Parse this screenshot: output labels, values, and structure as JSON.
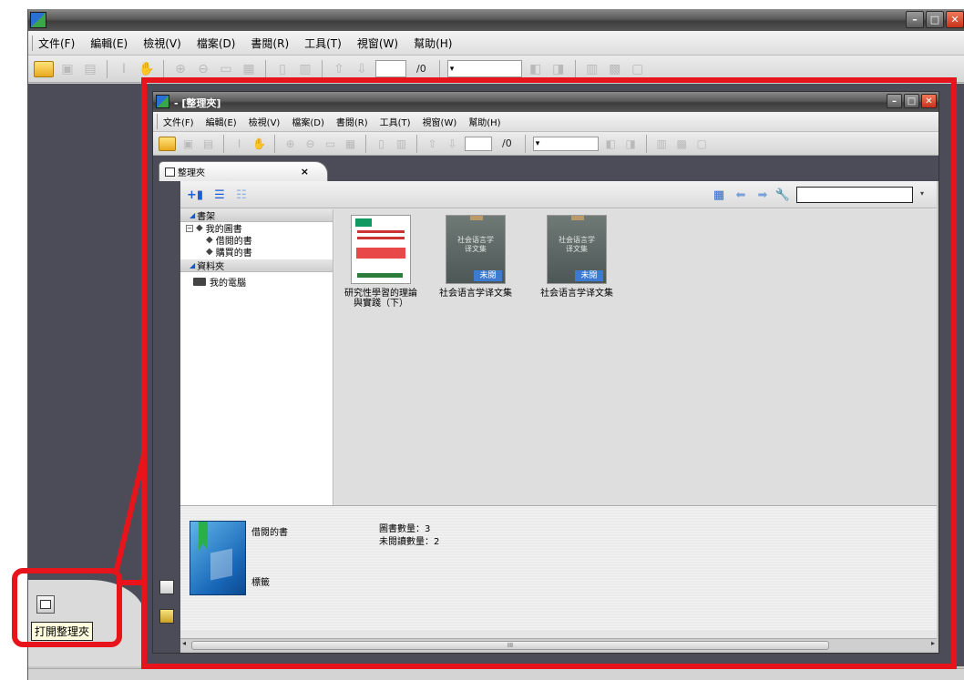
{
  "app": {
    "menu": [
      "文件(F)",
      "編輯(E)",
      "檢視(V)",
      "檔案(D)",
      "書閱(R)",
      "工具(T)",
      "視窗(W)",
      "幫助(H)"
    ],
    "window_buttons": [
      "–",
      "□",
      "✕"
    ],
    "toolbar": {
      "page_total": "/0",
      "zoom_arrow": "▾"
    },
    "tooltip": "打開整理夾"
  },
  "inner": {
    "title": "- [整理夾]",
    "menu": [
      "文件(F)",
      "編輯(E)",
      "檢視(V)",
      "檔案(D)",
      "書閱(R)",
      "工具(T)",
      "視窗(W)",
      "幫助(H)"
    ],
    "toolbar": {
      "page_total": "/0",
      "zoom_arrow": "▾"
    },
    "tab": {
      "label": "整理夾",
      "close": "×"
    },
    "tree": {
      "bookshelf": "書架",
      "my_books": "我的圖書",
      "borrowed": "借閱的書",
      "purchased": "購買的書",
      "folders": "資料夾",
      "my_computer": "我的電腦"
    },
    "books": [
      {
        "title": "研究性學習的理論與實踐（下）",
        "unread": ""
      },
      {
        "title": "社会语言学译文集",
        "cover_text": "社会语言学\n译文集",
        "unread": "未閱"
      },
      {
        "title": "社会语言学译文集",
        "cover_text": "社会语言学\n译文集",
        "unread": "未閱"
      }
    ],
    "info": {
      "shelf_name": "借閱的書",
      "tag_label": "標籤",
      "book_count": "圖書數量：3",
      "unread_count": "未閱讀數量：2"
    },
    "scroll_grip": "III"
  },
  "colors": {
    "highlight": "#e8141c",
    "unread_badge": "#3d7bd3",
    "dock": "#4b4c57"
  }
}
